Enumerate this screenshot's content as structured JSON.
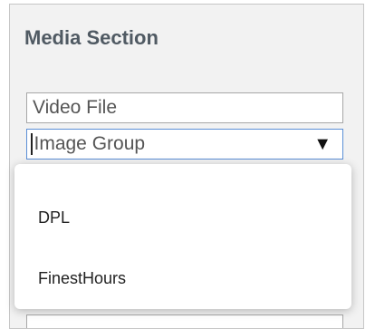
{
  "section": {
    "title": "Media Section"
  },
  "video_file": {
    "placeholder": "Video File"
  },
  "image_group": {
    "placeholder": "Image Group",
    "arrow": "▼"
  },
  "dropdown": {
    "options": [
      "DPL",
      "FinestHours"
    ]
  },
  "colors": {
    "focus_border": "#5b8fd6",
    "title_text": "#505a63"
  }
}
